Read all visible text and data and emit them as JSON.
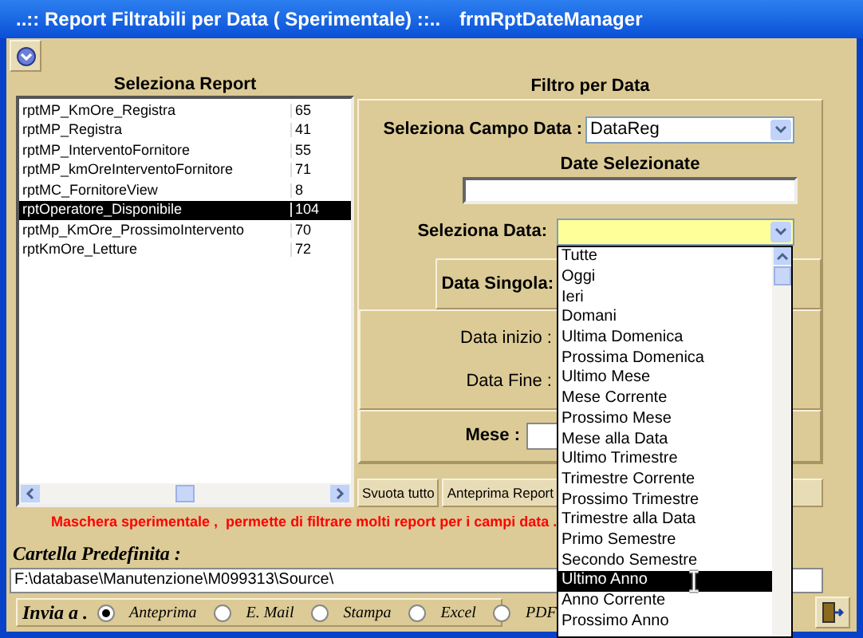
{
  "window": {
    "title": "..:: Report Filtrabili per Data ( Sperimentale) ::..",
    "form_name": "frmRptDateManager"
  },
  "report_list": {
    "heading": "Seleziona Report",
    "rows": [
      {
        "name": "rptMP_KmOre_Registra",
        "count": "65",
        "selected": false
      },
      {
        "name": "rptMP_Registra",
        "count": "41",
        "selected": false
      },
      {
        "name": "rptMP_InterventoFornitore",
        "count": "55",
        "selected": false
      },
      {
        "name": "rptMP_kmOreInterventoFornitore",
        "count": "71",
        "selected": false
      },
      {
        "name": "rptMC_FornitoreView",
        "count": "8",
        "selected": false
      },
      {
        "name": "rptOperatore_Disponibile",
        "count": "104",
        "selected": true
      },
      {
        "name": "rptMp_KmOre_ProssimoIntervento",
        "count": "70",
        "selected": false
      },
      {
        "name": "rptKmOre_Letture",
        "count": "72",
        "selected": false
      }
    ]
  },
  "date_filter": {
    "heading": "Filtro per Data",
    "date_field": {
      "label": "Seleziona Campo Data :",
      "value": "DataReg"
    },
    "selected_dates": {
      "label": "Date Selezionate"
    },
    "date_select": {
      "label": "Seleziona Data:",
      "expanded": true,
      "options": [
        {
          "label": "Tutte",
          "selected": false
        },
        {
          "label": "Oggi",
          "selected": false
        },
        {
          "label": "Ieri",
          "selected": false
        },
        {
          "label": "Domani",
          "selected": false
        },
        {
          "label": "Ultima Domenica",
          "selected": false
        },
        {
          "label": "Prossima Domenica",
          "selected": false
        },
        {
          "label": "Ultimo Mese",
          "selected": false
        },
        {
          "label": "Mese Corrente",
          "selected": false
        },
        {
          "label": "Prossimo Mese",
          "selected": false
        },
        {
          "label": "Mese alla Data",
          "selected": false
        },
        {
          "label": "Ultimo Trimestre",
          "selected": false
        },
        {
          "label": "Trimestre Corrente",
          "selected": false
        },
        {
          "label": "Prossimo Trimestre",
          "selected": false
        },
        {
          "label": "Trimestre alla Data",
          "selected": false
        },
        {
          "label": "Primo Semestre",
          "selected": false
        },
        {
          "label": "Secondo Semestre",
          "selected": false
        },
        {
          "label": "Ultimo Anno",
          "selected": true
        },
        {
          "label": "Anno Corrente",
          "selected": false
        },
        {
          "label": "Prossimo Anno",
          "selected": false
        }
      ]
    },
    "single_date": {
      "label": "Data Singola:"
    },
    "start_date": {
      "label": "Data inizio :"
    },
    "end_date": {
      "label": "Data Fine :"
    },
    "month": {
      "label": "Mese :"
    }
  },
  "buttons": [
    "Svuota tutto",
    "Anteprima Report"
  ],
  "notice": "Maschera sperimentale ,  permette di filtrare molti report per i campi data .",
  "default_folder": {
    "label": "Cartella Predefinita :",
    "value": "F:\\database\\Manutenzione\\M099313\\Source\\"
  },
  "send_to": {
    "label": "Invia a .",
    "options": [
      {
        "label": "Anteprima",
        "selected": true
      },
      {
        "label": "E. Mail",
        "selected": false
      },
      {
        "label": "Stampa",
        "selected": false
      },
      {
        "label": "Excel",
        "selected": false
      },
      {
        "label": "PDF",
        "selected": false
      }
    ]
  }
}
